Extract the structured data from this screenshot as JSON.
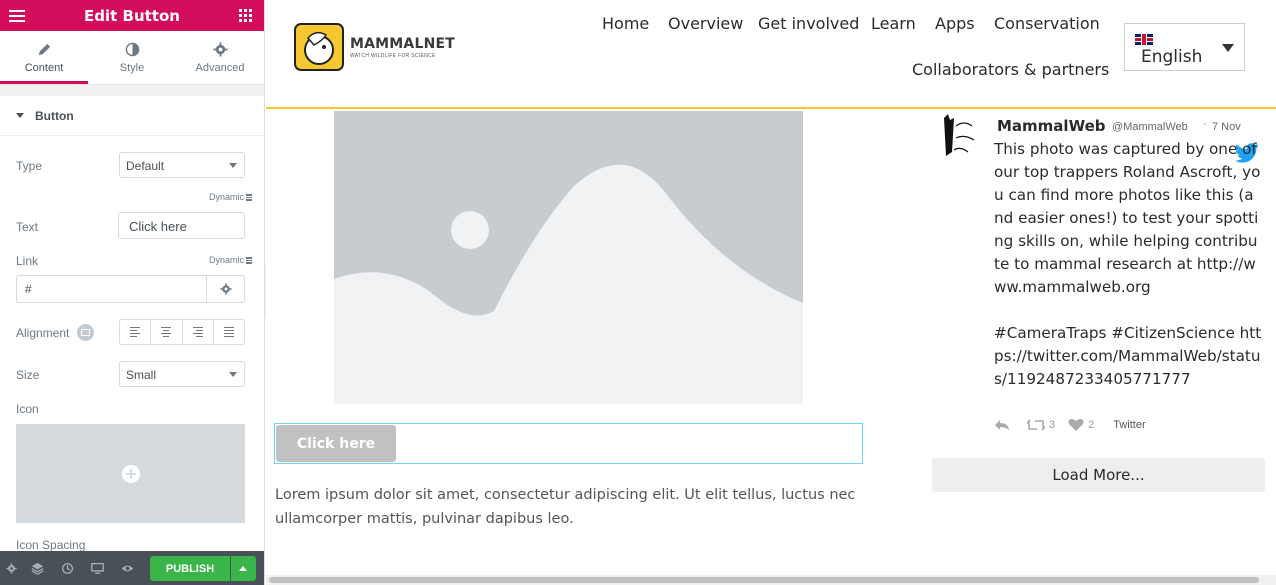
{
  "panel": {
    "title": "Edit Button",
    "tabs": [
      {
        "label": "Content"
      },
      {
        "label": "Style"
      },
      {
        "label": "Advanced"
      }
    ],
    "section": "Button",
    "controls": {
      "type": {
        "label": "Type",
        "value": "Default"
      },
      "dynamic_label": "Dynamic",
      "text": {
        "label": "Text",
        "value": "Click here"
      },
      "link": {
        "label": "Link",
        "value": "#"
      },
      "alignment": {
        "label": "Alignment"
      },
      "size": {
        "label": "Size",
        "value": "Small"
      },
      "icon": {
        "label": "Icon"
      },
      "icon_spacing": {
        "label": "Icon Spacing"
      }
    },
    "footer": {
      "publish_label": "PUBLISH"
    },
    "accent_color": "#d30c5c",
    "publish_color": "#39b54a"
  },
  "site": {
    "logo": {
      "name": "MAMMALNET",
      "tagline": "WATCH WILDLIFE FOR SCIENCE"
    },
    "nav": [
      "Home",
      "Overview",
      "Get involved",
      "Learn",
      "Apps",
      "Conservation",
      "Collaborators & partners"
    ],
    "language": "English",
    "button_label": "Click here",
    "lorem": "Lorem ipsum dolor sit amet, consectetur adipiscing elit. Ut elit tellus, luctus nec ullamcorper mattis, pulvinar dapibus leo.",
    "accent_color": "#f5c832"
  },
  "tweet": {
    "name": "MammalWeb",
    "handle": "@MammalWeb",
    "dot": "·",
    "date": "7 Nov",
    "text": "This photo was captured by one of our top trappers Roland Ascroft, you can find more photos like this (and easier ones!) to test your spotting skills on, while helping contribute to mammal research at http://www.mammalweb.org\n\n#CameraTraps #CitizenScience https://twitter.com/MammalWeb/status/1192487233405771777",
    "retweets": "3",
    "likes": "2",
    "source": "Twitter",
    "load_more": "Load More..."
  }
}
